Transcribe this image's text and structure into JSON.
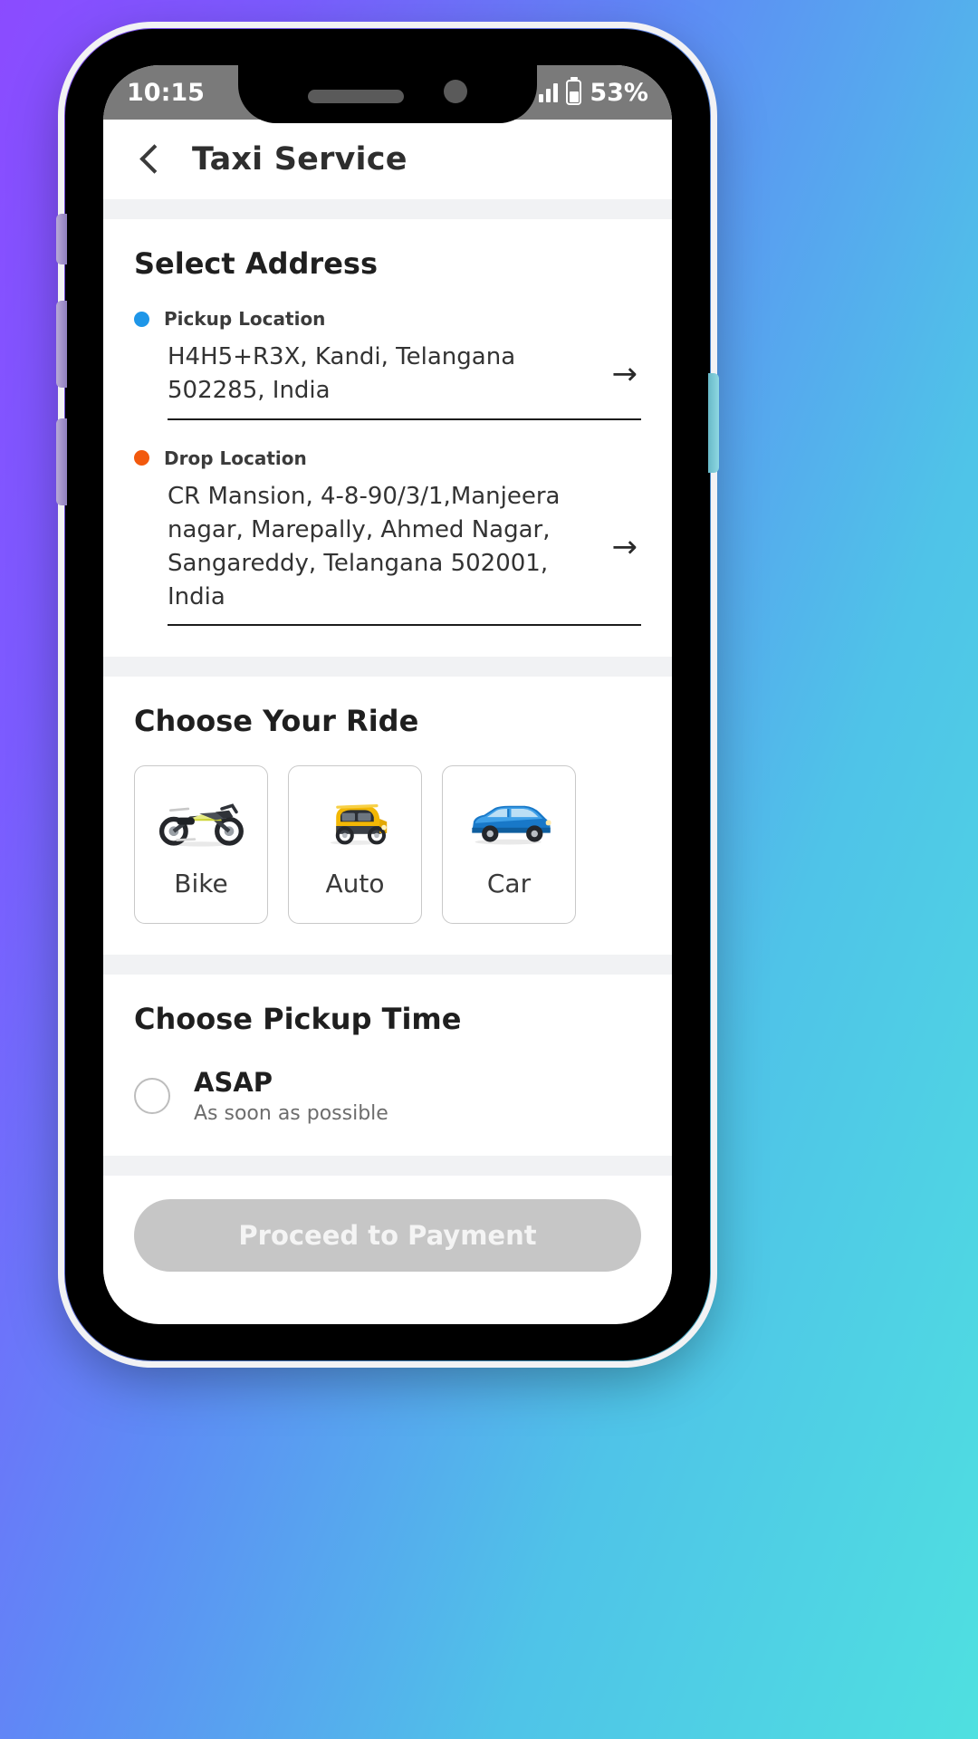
{
  "status_bar": {
    "time": "10:15",
    "battery_percent": "53%",
    "signal_icon": "signal-bars-icon",
    "battery_icon": "battery-icon"
  },
  "appbar": {
    "back_icon": "back-chevron-icon",
    "title": "Taxi Service"
  },
  "address_section": {
    "title": "Select Address",
    "pickup": {
      "label": "Pickup Location",
      "dot_color": "#1e96e8",
      "value": "H4H5+R3X, Kandi, Telangana 502285, India",
      "arrow": "→"
    },
    "drop": {
      "label": "Drop Location",
      "dot_color": "#f2590d",
      "value": "CR Mansion, 4-8-90/3/1,Manjeera nagar, Marepally, Ahmed Nagar, Sangareddy, Telangana 502001, India",
      "arrow": "→"
    }
  },
  "ride_section": {
    "title": "Choose Your Ride",
    "options": [
      {
        "name": "Bike",
        "icon": "motorcycle-icon"
      },
      {
        "name": "Auto",
        "icon": "auto-rickshaw-icon"
      },
      {
        "name": "Car",
        "icon": "car-icon"
      }
    ]
  },
  "pickup_time_section": {
    "title": "Choose Pickup Time",
    "options": [
      {
        "label": "ASAP",
        "sublabel": "As soon as possible",
        "selected": false
      }
    ]
  },
  "footer": {
    "proceed_label": "Proceed to Payment",
    "proceed_enabled": false,
    "disabled_color": "#c6c6c6"
  }
}
